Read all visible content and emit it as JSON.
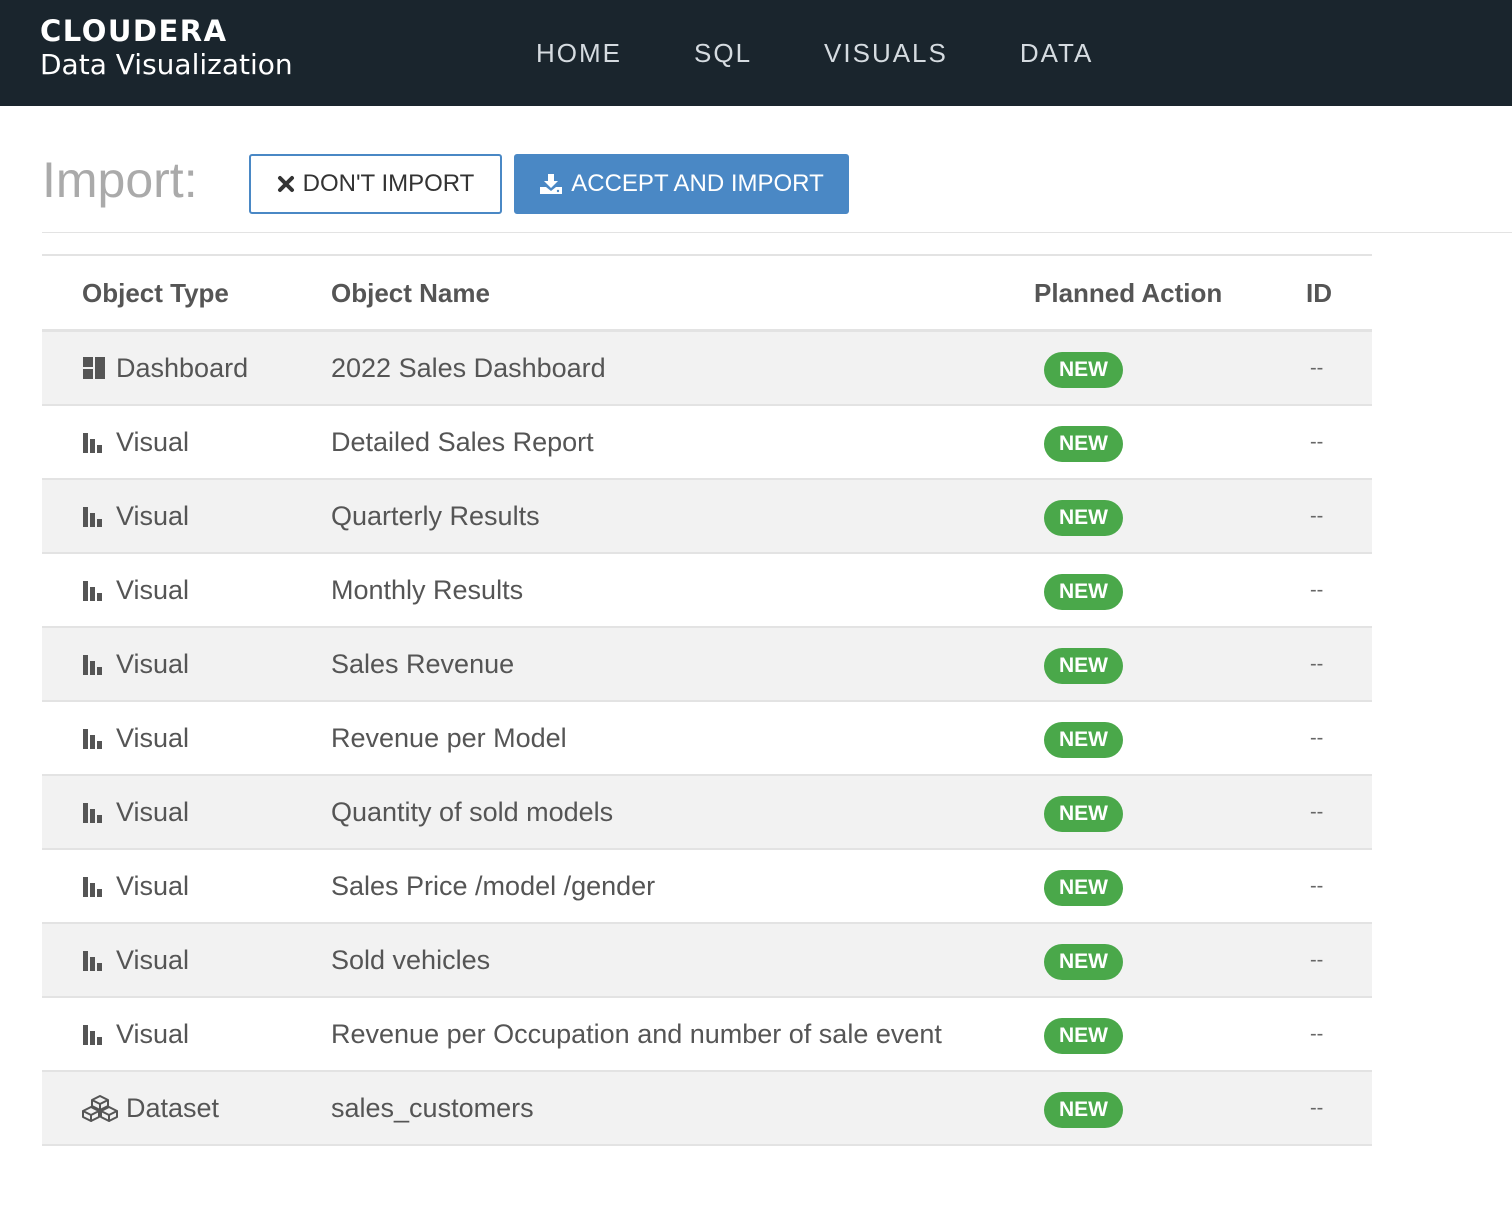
{
  "header": {
    "brand_name": "CLOUDERA",
    "brand_sub": "Data Visualization",
    "nav": [
      "HOME",
      "SQL",
      "VISUALS",
      "DATA"
    ]
  },
  "import": {
    "title": "Import:",
    "dont_import_label": "DON'T IMPORT",
    "accept_label": "ACCEPT AND IMPORT"
  },
  "table": {
    "columns": [
      "Object Type",
      "Object Name",
      "Planned Action",
      "ID"
    ],
    "rows": [
      {
        "type": "Dashboard",
        "icon": "dashboard-icon",
        "name": "2022 Sales Dashboard",
        "action": "NEW",
        "id": "--"
      },
      {
        "type": "Visual",
        "icon": "bar-chart-icon",
        "name": "Detailed Sales Report",
        "action": "NEW",
        "id": "--"
      },
      {
        "type": "Visual",
        "icon": "bar-chart-icon",
        "name": "Quarterly Results",
        "action": "NEW",
        "id": "--"
      },
      {
        "type": "Visual",
        "icon": "bar-chart-icon",
        "name": "Monthly Results",
        "action": "NEW",
        "id": "--"
      },
      {
        "type": "Visual",
        "icon": "bar-chart-icon",
        "name": "Sales Revenue",
        "action": "NEW",
        "id": "--"
      },
      {
        "type": "Visual",
        "icon": "bar-chart-icon",
        "name": "Revenue per Model",
        "action": "NEW",
        "id": "--"
      },
      {
        "type": "Visual",
        "icon": "bar-chart-icon",
        "name": "Quantity of sold models",
        "action": "NEW",
        "id": "--"
      },
      {
        "type": "Visual",
        "icon": "bar-chart-icon",
        "name": "Sales Price /model /gender",
        "action": "NEW",
        "id": "--"
      },
      {
        "type": "Visual",
        "icon": "bar-chart-icon",
        "name": "Sold vehicles",
        "action": "NEW",
        "id": "--"
      },
      {
        "type": "Visual",
        "icon": "bar-chart-icon",
        "name": "Revenue per Occupation and number of sale event",
        "action": "NEW",
        "id": "--"
      },
      {
        "type": "Dataset",
        "icon": "dataset-cubes-icon",
        "name": "sales_customers",
        "action": "NEW",
        "id": "--"
      }
    ]
  },
  "colors": {
    "topbar": "#1a252d",
    "accent": "#4a88c5",
    "badge_green": "#4aa84a"
  }
}
